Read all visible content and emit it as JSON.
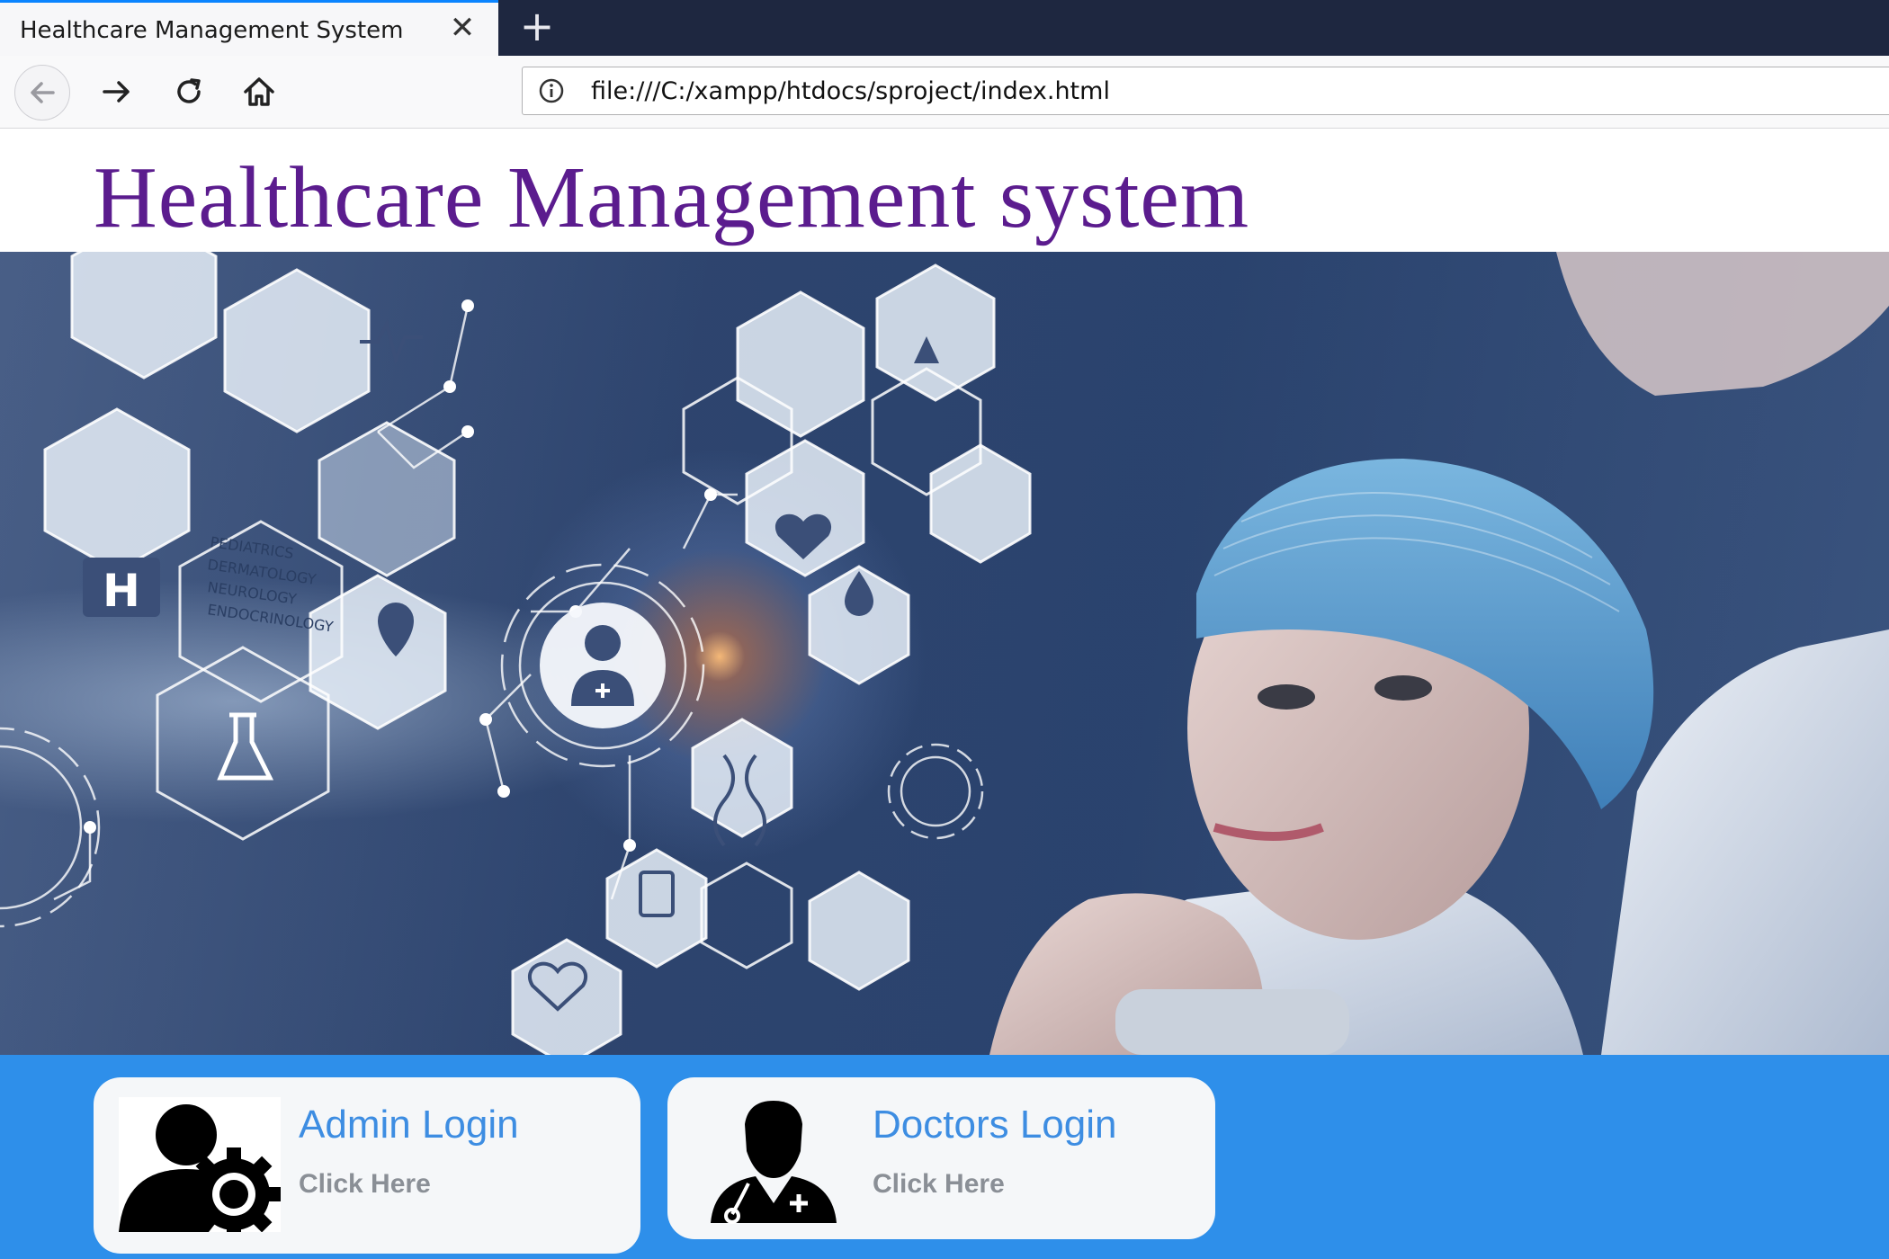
{
  "browser": {
    "tab_title": "Healthcare Management System",
    "tab_close_icon": "close-icon",
    "new_tab_icon": "plus-icon",
    "url": "file:///C:/xampp/htdocs/sproject/index.html",
    "nav_icons": [
      "back-arrow-icon",
      "forward-arrow-icon",
      "reload-icon",
      "home-icon",
      "info-icon"
    ]
  },
  "page": {
    "heading": "Healthcare Management system",
    "heading_color": "#5b1c8e",
    "bar_color": "#2e8fea",
    "hero": {
      "hex_labels": [
        "PEDIATRICS",
        "DERMATOLOGY",
        "NEUROLOGY",
        "ENDOCRINOLOGY"
      ]
    },
    "cards": [
      {
        "title": "Admin Login",
        "subtitle": "Click Here",
        "icon": "admin-gear-icon"
      },
      {
        "title": "Doctors Login",
        "subtitle": "Click Here",
        "icon": "doctor-icon"
      }
    ]
  }
}
